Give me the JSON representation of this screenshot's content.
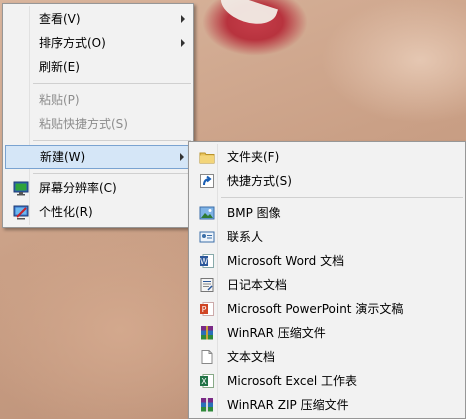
{
  "context_menu": {
    "items": [
      {
        "label": "查看(V)",
        "has_submenu": true,
        "disabled": false
      },
      {
        "label": "排序方式(O)",
        "has_submenu": true,
        "disabled": false
      },
      {
        "label": "刷新(E)",
        "has_submenu": false,
        "disabled": false
      },
      {
        "label": "粘贴(P)",
        "has_submenu": false,
        "disabled": true
      },
      {
        "label": "粘贴快捷方式(S)",
        "has_submenu": false,
        "disabled": true
      },
      {
        "label": "新建(W)",
        "has_submenu": true,
        "disabled": false,
        "highlighted": true
      },
      {
        "label": "屏幕分辨率(C)",
        "icon": "display-icon",
        "disabled": false
      },
      {
        "label": "个性化(R)",
        "icon": "personalize-icon",
        "disabled": false
      }
    ]
  },
  "new_submenu": {
    "items": [
      {
        "label": "文件夹(F)",
        "icon": "folder-icon"
      },
      {
        "label": "快捷方式(S)",
        "icon": "shortcut-icon"
      },
      {
        "label": "BMP 图像",
        "icon": "bitmap-icon"
      },
      {
        "label": "联系人",
        "icon": "contact-icon"
      },
      {
        "label": "Microsoft Word 文档",
        "icon": "word-icon"
      },
      {
        "label": "日记本文档",
        "icon": "journal-icon"
      },
      {
        "label": "Microsoft PowerPoint 演示文稿",
        "icon": "powerpoint-icon"
      },
      {
        "label": "WinRAR 压缩文件",
        "icon": "winrar-icon"
      },
      {
        "label": "文本文档",
        "icon": "text-document-icon"
      },
      {
        "label": "Microsoft Excel 工作表",
        "icon": "excel-icon"
      },
      {
        "label": "WinRAR ZIP 压缩文件",
        "icon": "winrar-zip-icon"
      }
    ]
  },
  "colors": {
    "menu_bg": "#f2f2f2",
    "highlight_bg": "#d5e6f7",
    "highlight_border": "#7aa3d1",
    "disabled_text": "#8d8d8d"
  }
}
